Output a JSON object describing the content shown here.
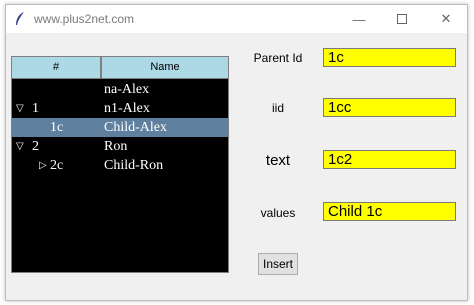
{
  "window": {
    "title": "www.plus2net.com"
  },
  "tree": {
    "columns": [
      "#",
      "Name"
    ],
    "rows": [
      {
        "id": "",
        "name": "na-Alex",
        "arrow": "",
        "selected": false
      },
      {
        "id": "1",
        "name": "n1-Alex",
        "arrow": "expanded",
        "selected": false
      },
      {
        "id": "1c",
        "name": "Child-Alex",
        "arrow": "",
        "selected": true
      },
      {
        "id": "2",
        "name": "Ron",
        "arrow": "expanded",
        "selected": false
      },
      {
        "id": "2c",
        "name": "Child-Ron",
        "arrow": "collapsed",
        "selected": false
      }
    ]
  },
  "form": {
    "parent_label": "Parent Id",
    "parent_value": "1c",
    "iid_label": "iid",
    "iid_value": "1cc",
    "text_label": "text",
    "text_value": "1c2",
    "values_label": "values",
    "values_value": "Child 1c",
    "insert_label": "Insert"
  },
  "colors": {
    "heading_bg": "#add8e6",
    "tree_bg": "#000000",
    "selected_bg": "#5f7f9f",
    "entry_bg": "#ffff00"
  }
}
